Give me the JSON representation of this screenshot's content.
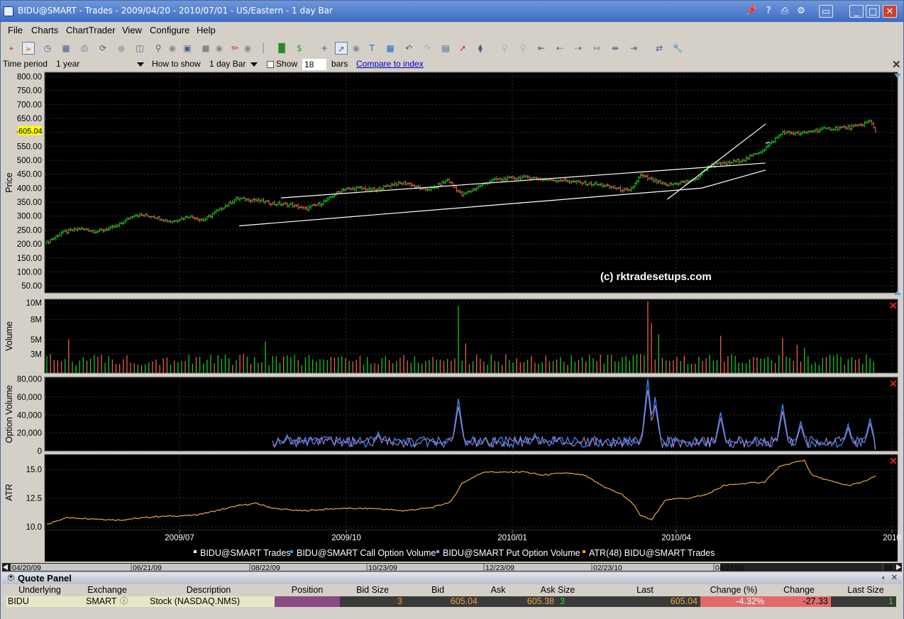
{
  "window": {
    "title": "BIDU@SMART - Trades - 2009/04/20 - 2010/07/01 - US/Eastern - 1 day Bar"
  },
  "menu": [
    "File",
    "Charts",
    "ChartTrader",
    "View",
    "Configure",
    "Help"
  ],
  "options": {
    "time_period_label": "Time period",
    "time_period_value": "1 year",
    "how_to_show_label": "How to show",
    "how_to_show_value": "1 day Bar",
    "show_label": "Show",
    "show_value": "18",
    "bars_label": "bars",
    "compare_link": "Compare to index"
  },
  "chart_data": [
    {
      "type": "ohlc",
      "panel": "price",
      "ylabel": "Price",
      "y_ticks": [
        "800.00",
        "750.00",
        "700.00",
        "650.00",
        "600.00",
        "550.00",
        "500.00",
        "450.00",
        "400.00",
        "350.00",
        "300.00",
        "250.00",
        "200.00",
        "150.00",
        "100.00",
        "50.00"
      ],
      "ylim": [
        25,
        815
      ],
      "last_price_label": "605.04",
      "watermark": "(c) rktradesetups.com",
      "series_name": "BIDU@SMART Trades",
      "closes_keypoints": [
        [
          0,
          205
        ],
        [
          8,
          240
        ],
        [
          18,
          255
        ],
        [
          28,
          245
        ],
        [
          38,
          262
        ],
        [
          48,
          305
        ],
        [
          58,
          300
        ],
        [
          68,
          280
        ],
        [
          78,
          300
        ],
        [
          86,
          285
        ],
        [
          94,
          320
        ],
        [
          104,
          362
        ],
        [
          114,
          358
        ],
        [
          124,
          345
        ],
        [
          134,
          340
        ],
        [
          142,
          325
        ],
        [
          152,
          350
        ],
        [
          162,
          395
        ],
        [
          172,
          400
        ],
        [
          180,
          392
        ],
        [
          190,
          415
        ],
        [
          198,
          418
        ],
        [
          206,
          395
        ],
        [
          212,
          398
        ],
        [
          220,
          430
        ],
        [
          228,
          375
        ],
        [
          234,
          395
        ],
        [
          244,
          428
        ],
        [
          254,
          435
        ],
        [
          264,
          440
        ],
        [
          274,
          430
        ],
        [
          284,
          428
        ],
        [
          294,
          418
        ],
        [
          304,
          412
        ],
        [
          312,
          400
        ],
        [
          320,
          388
        ],
        [
          326,
          445
        ],
        [
          332,
          430
        ],
        [
          340,
          410
        ],
        [
          348,
          420
        ],
        [
          356,
          430
        ],
        [
          364,
          482
        ],
        [
          374,
          490
        ],
        [
          384,
          505
        ],
        [
          394,
          540
        ],
        [
          404,
          600
        ],
        [
          414,
          595
        ],
        [
          424,
          610
        ],
        [
          434,
          615
        ],
        [
          444,
          620
        ],
        [
          452,
          640
        ],
        [
          455,
          605
        ]
      ],
      "trendlines": [
        {
          "x1": 0.228,
          "y1": 265,
          "x2": 0.77,
          "y2": 400
        },
        {
          "x1": 0.277,
          "y1": 365,
          "x2": 0.845,
          "y2": 490
        },
        {
          "x1": 0.77,
          "y1": 400,
          "x2": 0.985,
          "y2": 465
        },
        {
          "x1": 0.73,
          "y1": 360,
          "x2": 0.985,
          "y2": 630
        },
        {
          "x1": 0.85,
          "y1": 565,
          "x2": 1.05,
          "y2": 735
        }
      ]
    },
    {
      "type": "bar",
      "panel": "volume",
      "ylabel": "Volume",
      "y_ticks": [
        "10M",
        "8M",
        "5M",
        "3M"
      ],
      "ylim": [
        0,
        10500000
      ],
      "spikes": [
        [
          12,
          4.8
        ],
        [
          120,
          4.5
        ],
        [
          226,
          9.5
        ],
        [
          230,
          4.2
        ],
        [
          330,
          10.2
        ],
        [
          333,
          7.1
        ],
        [
          336,
          5.5
        ],
        [
          370,
          5.3
        ],
        [
          404,
          5.0
        ],
        [
          413,
          4.0
        ],
        [
          416,
          3.6
        ]
      ]
    },
    {
      "type": "line",
      "panel": "option_volume",
      "ylabel": "Option Volume",
      "y_ticks": [
        "80,000",
        "60,000",
        "40,000",
        "20,000",
        "0"
      ],
      "ylim": [
        0,
        82000
      ],
      "series": [
        {
          "name": "BIDU@SMART Call Option Volume",
          "color": "#3e86f0"
        },
        {
          "name": "BIDU@SMART Put Option Volume",
          "color": "#b28ce6"
        }
      ],
      "peaks": [
        [
          132,
          18000
        ],
        [
          182,
          21000
        ],
        [
          226,
          58000
        ],
        [
          268,
          19000
        ],
        [
          330,
          80000
        ],
        [
          334,
          60000
        ],
        [
          370,
          43000
        ],
        [
          404,
          52000
        ],
        [
          414,
          33000
        ],
        [
          440,
          30000
        ],
        [
          452,
          36000
        ]
      ]
    },
    {
      "type": "line",
      "panel": "atr",
      "ylabel": "ATR",
      "y_ticks": [
        "15.0",
        "12.5",
        "10.0"
      ],
      "ylim": [
        9.7,
        16.3
      ],
      "series": [
        {
          "name": "ATR(48) BIDU@SMART Trades",
          "color": "#f0a540"
        }
      ],
      "keypoints": [
        [
          0,
          10.2
        ],
        [
          10,
          10.8
        ],
        [
          20,
          10.75
        ],
        [
          40,
          10.6
        ],
        [
          60,
          10.9
        ],
        [
          80,
          11.0
        ],
        [
          90,
          11.3
        ],
        [
          105,
          11.85
        ],
        [
          115,
          12.05
        ],
        [
          125,
          11.6
        ],
        [
          140,
          11.4
        ],
        [
          160,
          11.6
        ],
        [
          180,
          11.6
        ],
        [
          196,
          11.4
        ],
        [
          212,
          11.7
        ],
        [
          222,
          12.2
        ],
        [
          228,
          13.8
        ],
        [
          240,
          14.8
        ],
        [
          252,
          14.75
        ],
        [
          262,
          14.8
        ],
        [
          272,
          14.5
        ],
        [
          284,
          14.7
        ],
        [
          295,
          14.5
        ],
        [
          306,
          13.5
        ],
        [
          316,
          12.8
        ],
        [
          322,
          12.0
        ],
        [
          326,
          11.0
        ],
        [
          332,
          10.6
        ],
        [
          340,
          12.4
        ],
        [
          352,
          12.5
        ],
        [
          362,
          12.8
        ],
        [
          372,
          13.6
        ],
        [
          384,
          13.8
        ],
        [
          394,
          13.9
        ],
        [
          402,
          15.2
        ],
        [
          410,
          15.6
        ],
        [
          416,
          15.8
        ],
        [
          420,
          14.5
        ],
        [
          430,
          14.0
        ],
        [
          440,
          13.6
        ],
        [
          448,
          13.9
        ],
        [
          455,
          14.4
        ]
      ],
      "x_tick_labels": [
        "2009/07",
        "2009/10",
        "2010/01",
        "2010/04",
        "2010"
      ]
    }
  ],
  "legend": [
    {
      "label": "BIDU@SMART Trades",
      "color": "#ffffff"
    },
    {
      "label": "BIDU@SMART Call Option Volume",
      "color": "#3e86f0"
    },
    {
      "label": "BIDU@SMART Put Option Volume",
      "color": "#b28ce6"
    },
    {
      "label": "ATR(48) BIDU@SMART Trades",
      "color": "#f0a540"
    }
  ],
  "scroll_dates": [
    "04/20/09",
    "06/21/09",
    "08/22/09",
    "10/23/09",
    "12/23/09",
    "02/23/10",
    "04/27/10",
    "06"
  ],
  "quote_panel": {
    "title": "Quote Panel",
    "headers": [
      "Underlying",
      "Exchange",
      "Description",
      "Position",
      "Bid Size",
      "Bid",
      "Ask",
      "Ask Size",
      "Last",
      "Change (%)",
      "Change",
      "Last Size"
    ],
    "row": {
      "underlying": "BIDU",
      "exchange": "SMART",
      "description": "Stock (NASDAQ.NMS)",
      "position": "",
      "bid_size": "3",
      "bid": "605.04",
      "ask": "605.38",
      "ask_size": "3",
      "last": "605.04",
      "change_pct": "-4.32%",
      "change": "-27.33",
      "last_size": "1"
    }
  },
  "colors": {
    "up": "#19c81e",
    "down": "#e8624a",
    "grid": "#303030",
    "trendline": "#ffffff",
    "last_price_tag": "#ffff00",
    "close_x": "#e02020"
  }
}
